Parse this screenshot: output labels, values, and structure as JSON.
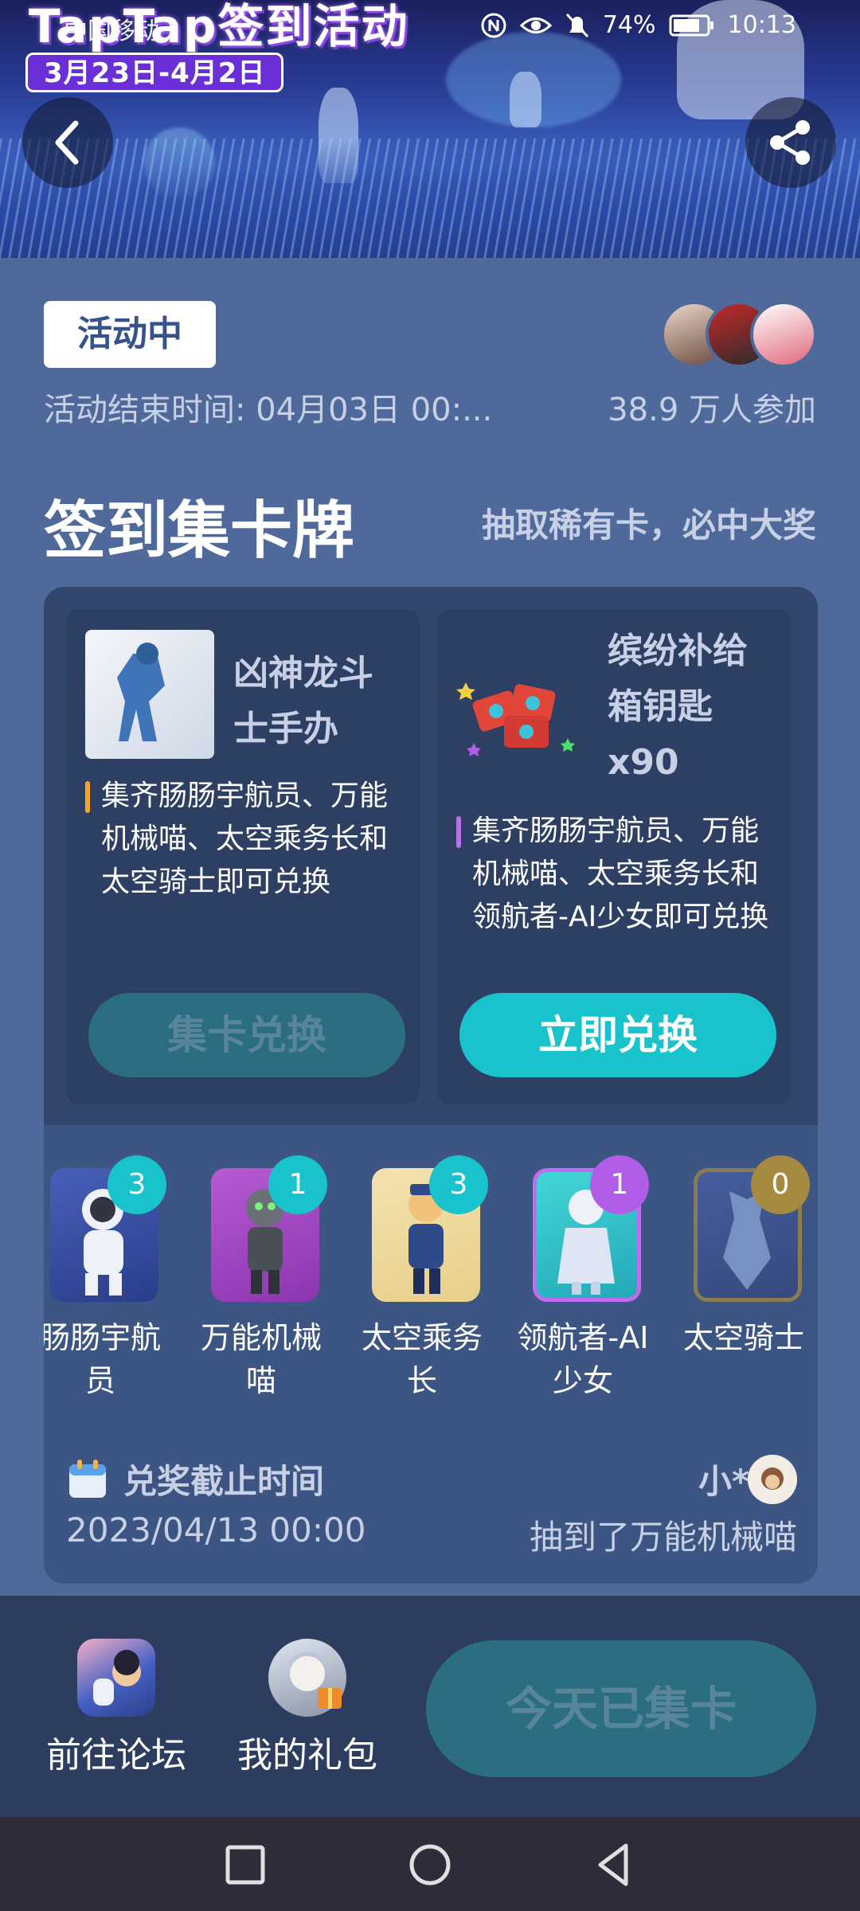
{
  "banner": {
    "title": "TapTap签到活动",
    "date_range": "3月23日-4月2日"
  },
  "statusbar": {
    "carrier": "中国移动",
    "battery": "74%",
    "time": "10:13"
  },
  "activity": {
    "status": "活动中",
    "end_time": "活动结束时间: 04月03日 00:...",
    "participants": "38.9 万人参加"
  },
  "section": {
    "title": "签到集卡牌",
    "subtitle": "抽取稀有卡，必中大奖"
  },
  "prizes": [
    {
      "name": "凶神龙斗士手办",
      "desc": "集齐肠肠宇航员、万能机械喵、太空乘务长和太空骑士即可兑换",
      "button": "集卡兑换",
      "accent": "#f5a623"
    },
    {
      "name": "缤纷补给箱钥匙x90",
      "desc": "集齐肠肠宇航员、万能机械喵、太空乘务长和领航者-AI少女即可兑换",
      "button": "立即兑换",
      "accent": "#c06cf0"
    }
  ],
  "cards": [
    {
      "label": "肠肠宇航员",
      "count": "3",
      "count_color": "#18c3cc"
    },
    {
      "label": "万能机械喵",
      "count": "1",
      "count_color": "#18c3cc"
    },
    {
      "label": "太空乘务长",
      "count": "3",
      "count_color": "#18c3cc"
    },
    {
      "label": "领航者-AI少女",
      "count": "1",
      "count_color": "#b25de8"
    },
    {
      "label": "太空骑士",
      "count": "0",
      "count_color": "#a58a40"
    }
  ],
  "deadline": {
    "label": "兑奖截止时间",
    "value": "2023/04/13 00:00"
  },
  "winner": {
    "name": "小*",
    "text": "抽到了万能机械喵"
  },
  "bottom": {
    "forum_label": "前往论坛",
    "gift_label": "我的礼包",
    "checkin_button": "今天已集卡"
  }
}
